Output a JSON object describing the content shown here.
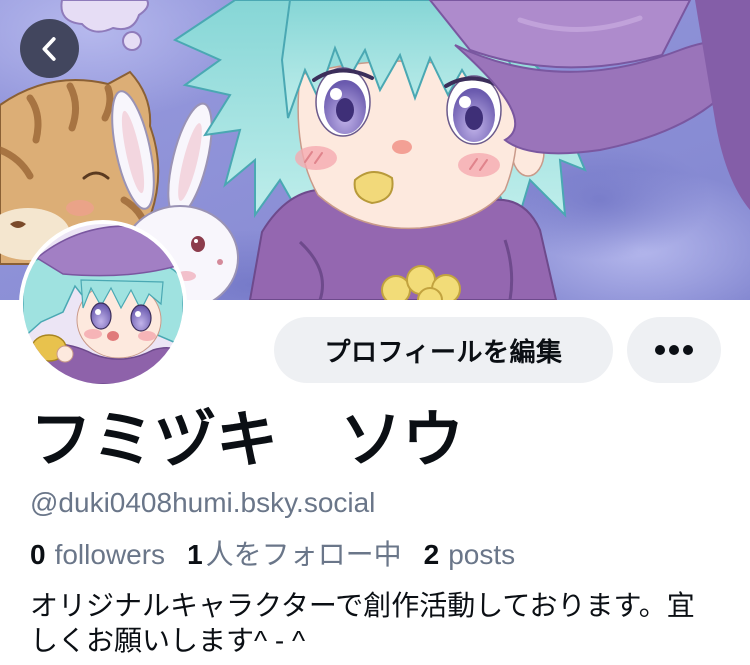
{
  "nav": {
    "back_button_icon": "chevron-left-icon"
  },
  "actions": {
    "edit_profile_label": "プロフィールを編集",
    "more_button_icon": "more-horizontal-icon"
  },
  "profile": {
    "display_name": "フミヅキ　ソウ",
    "handle": "@duki0408humi.bsky.social",
    "stats": {
      "followers": {
        "count": 0,
        "label": "followers"
      },
      "following": {
        "count": 1,
        "label": "人をフォロー中"
      },
      "posts": {
        "count": 2,
        "label": "posts"
      }
    },
    "bio": "オリジナルキャラクターで創作活動しております。宜しくお願いします^ - ^"
  },
  "colors": {
    "text_primary": "#0b0f14",
    "text_secondary": "#6a7689",
    "button_background": "#eef0f3",
    "back_button_background": "#42465e",
    "page_background": "#ffffff"
  }
}
